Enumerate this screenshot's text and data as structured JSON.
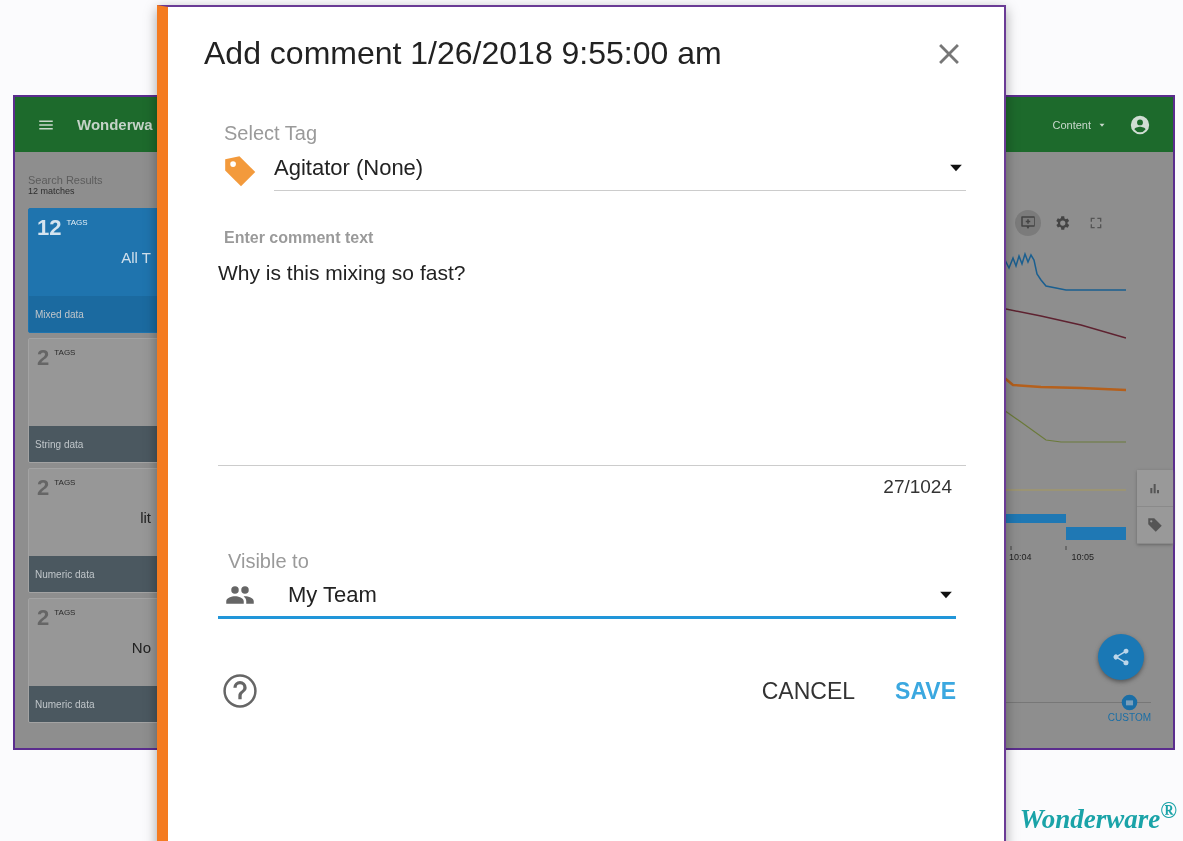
{
  "app": {
    "title": "Wonderwa",
    "menu_label": "Content",
    "results": {
      "title": "Search Results",
      "count": "12 matches"
    },
    "cards": [
      {
        "count": "12",
        "unit": "TAGS",
        "name": "All T",
        "footer": "Mixed data",
        "selected": true
      },
      {
        "count": "2",
        "unit": "TAGS",
        "footer": "String data",
        "selected": false
      },
      {
        "count": "2",
        "unit": "TAGS",
        "name": "lit",
        "footer": "Numeric data",
        "selected": false
      },
      {
        "count": "2",
        "unit": "TAGS",
        "name": "No",
        "footer": "Numeric data",
        "selected": false
      }
    ],
    "toolbar": [
      {
        "kind": "comment",
        "selected": true
      },
      {
        "kind": "settings",
        "selected": false
      },
      {
        "kind": "fullscreen",
        "selected": false
      }
    ],
    "side_tabs": [
      {
        "kind": "chart"
      },
      {
        "kind": "tag"
      }
    ],
    "x_ticks": [
      "10:04",
      "10:05"
    ],
    "range": {
      "label": "CUSTOM"
    }
  },
  "dialog": {
    "title": "Add comment 1/26/2018 9:55:00 am",
    "tag_field": {
      "label": "Select Tag",
      "value": "Agitator (None)",
      "focused": false
    },
    "comment_field": {
      "label": "Enter comment text",
      "value": "Why is this mixing so fast?",
      "counter": "27/1024"
    },
    "visibility_field": {
      "label": "Visible to",
      "value": "My Team",
      "focused": true
    },
    "buttons": [
      {
        "label": "CANCEL",
        "kind": "secondary"
      },
      {
        "label": "SAVE",
        "kind": "primary"
      }
    ]
  },
  "brand": {
    "logo": "Wonderware$^{®}$"
  }
}
